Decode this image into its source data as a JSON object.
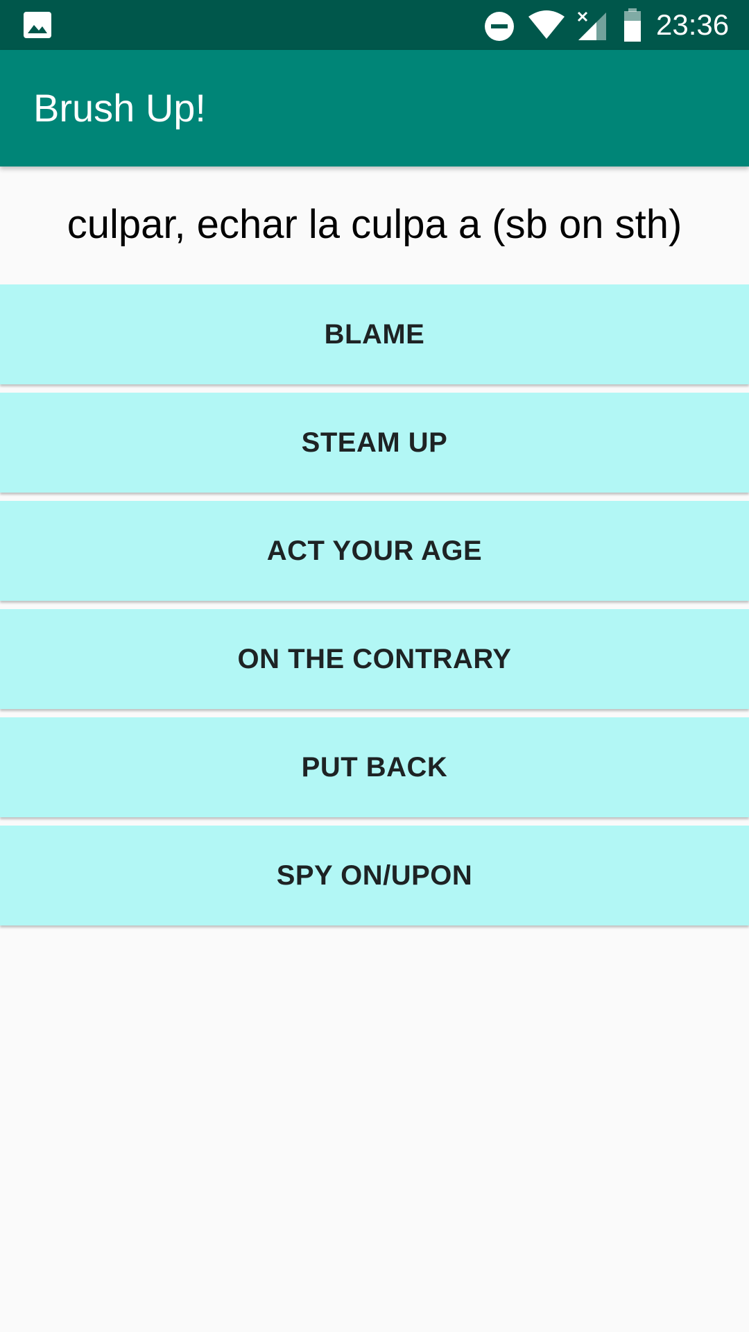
{
  "status_bar": {
    "time": "23:36",
    "icons": [
      "gallery-icon",
      "do-not-disturb-icon",
      "wifi-icon",
      "signal-icon",
      "battery-icon"
    ]
  },
  "app_bar": {
    "title": "Brush Up!"
  },
  "quiz": {
    "question": "culpar, echar la culpa a (sb on sth)",
    "answers": [
      {
        "label": "BLAME"
      },
      {
        "label": "STEAM UP"
      },
      {
        "label": "ACT YOUR AGE"
      },
      {
        "label": "ON THE CONTRARY"
      },
      {
        "label": "PUT BACK"
      },
      {
        "label": "SPY ON/UPON"
      }
    ]
  },
  "colors": {
    "status_bar": "#00574b",
    "app_bar": "#008577",
    "answer_button": "#b2f7f5",
    "background": "#fafafa"
  }
}
